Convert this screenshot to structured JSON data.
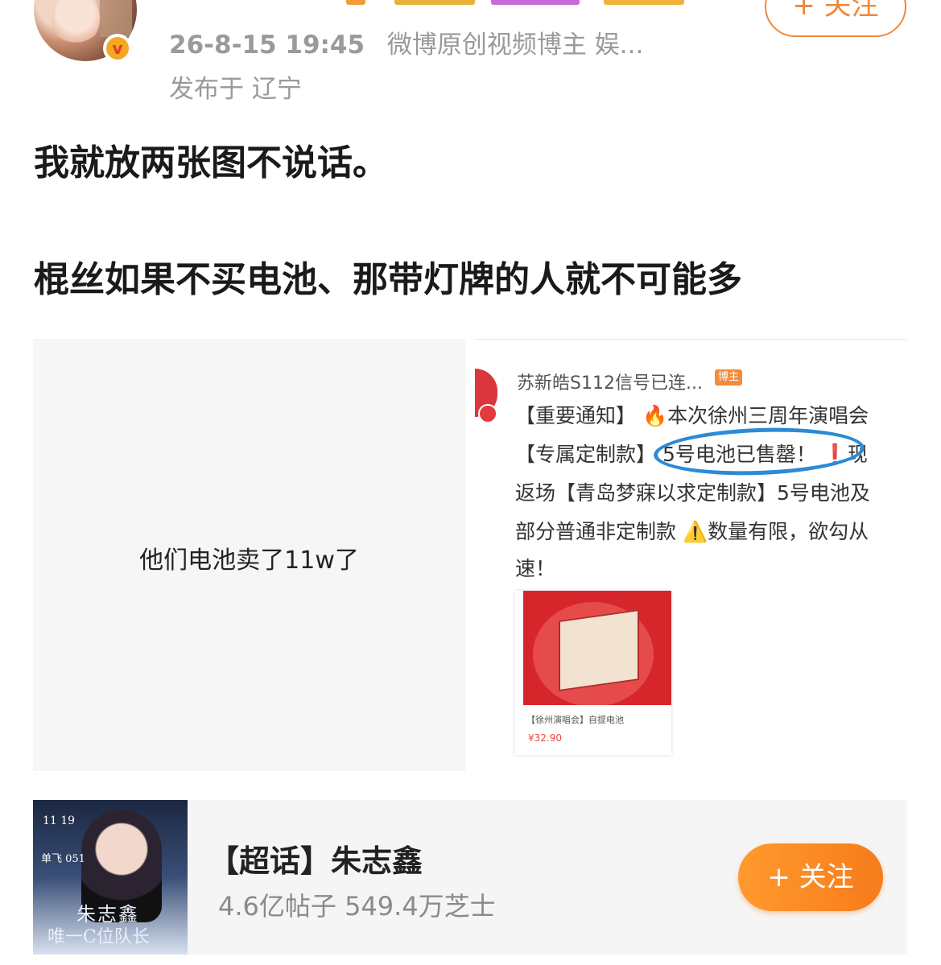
{
  "header": {
    "timestamp": "26-8-15 19:45",
    "author_tag": "微博原创视频博主 娱...",
    "location": "发布于 辽宁",
    "follow_label": "+ 关注",
    "verified_badge": "v"
  },
  "post": {
    "line1": "我就放两张图不说话。",
    "line2": "棍丝如果不买电池、那带灯牌的人就不可能多"
  },
  "images": {
    "left_caption": "他们电池卖了11w了",
    "right": {
      "username": "苏新皓S112信号已连...",
      "user_tag": "博主",
      "lines": [
        "【重要通知】 🔥本次徐州三周年演唱会",
        "【专属定制款】 5号电池已售罄！ ❗现",
        "返场【青岛梦寐以求定制款】5号电池及",
        "部分普通非定制款 ⚠️数量有限，欲勾从",
        "速！"
      ],
      "product_title": "【徐州演唱会】自提电池",
      "product_price": "¥32.90"
    }
  },
  "supertopic": {
    "title": "【超话】朱志鑫",
    "stats": "4.6亿帖子 549.4万芝士",
    "follow_label": "+ 关注",
    "cover_text_date": "11 19",
    "cover_text_flight": "单飞 051",
    "cover_text_name": "朱志鑫",
    "cover_text_slogan": "唯一C位队长"
  },
  "colors": {
    "accent_orange": "#f77b1b",
    "meta_gray": "#9a9a9a",
    "circle_blue": "#2c8ad6"
  }
}
